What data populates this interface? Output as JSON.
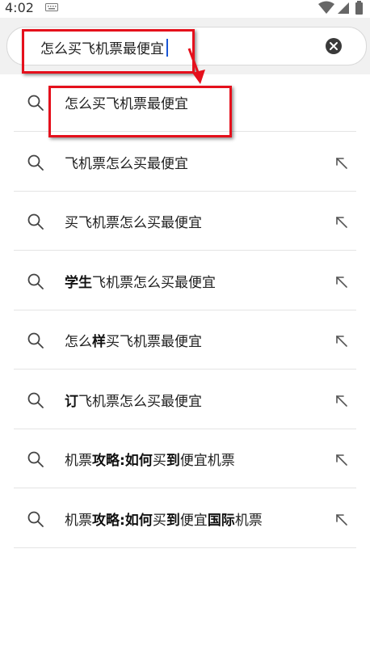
{
  "status": {
    "time": "4:02"
  },
  "search": {
    "query": "怎么买飞机票最便宜"
  },
  "suggestions": [
    {
      "parts": [
        {
          "t": "怎么买飞机票最便宜",
          "b": false
        }
      ],
      "fill": false
    },
    {
      "parts": [
        {
          "t": "飞机票怎么买最便宜",
          "b": false
        }
      ],
      "fill": true
    },
    {
      "parts": [
        {
          "t": "买飞机票怎么买最便宜",
          "b": false
        }
      ],
      "fill": true
    },
    {
      "parts": [
        {
          "t": "学生",
          "b": true
        },
        {
          "t": "飞机票怎么买最便宜",
          "b": false
        }
      ],
      "fill": true
    },
    {
      "parts": [
        {
          "t": "怎么",
          "b": false
        },
        {
          "t": "样",
          "b": true
        },
        {
          "t": "买飞机票最便宜",
          "b": false
        }
      ],
      "fill": true
    },
    {
      "parts": [
        {
          "t": "订",
          "b": true
        },
        {
          "t": "飞机票怎么买最便宜",
          "b": false
        }
      ],
      "fill": true
    },
    {
      "parts": [
        {
          "t": "机票",
          "b": false
        },
        {
          "t": "攻略:如何",
          "b": true
        },
        {
          "t": "买",
          "b": false
        },
        {
          "t": "到",
          "b": true
        },
        {
          "t": "便宜机票",
          "b": false
        }
      ],
      "fill": true
    },
    {
      "parts": [
        {
          "t": "机票",
          "b": false
        },
        {
          "t": "攻略:如何",
          "b": true
        },
        {
          "t": "买",
          "b": false
        },
        {
          "t": "到",
          "b": true
        },
        {
          "t": "便宜",
          "b": false
        },
        {
          "t": "国际",
          "b": true
        },
        {
          "t": "机票",
          "b": false
        }
      ],
      "fill": true
    }
  ],
  "icons": {
    "search": "search-icon",
    "fill": "arrow-up-left-icon",
    "clear": "clear-icon",
    "keyboard": "keyboard-icon",
    "wifi": "wifi-icon",
    "signal": "signal-icon",
    "battery": "battery-icon"
  },
  "colors": {
    "annotation": "#e5101c",
    "caret": "#1a57d6"
  }
}
